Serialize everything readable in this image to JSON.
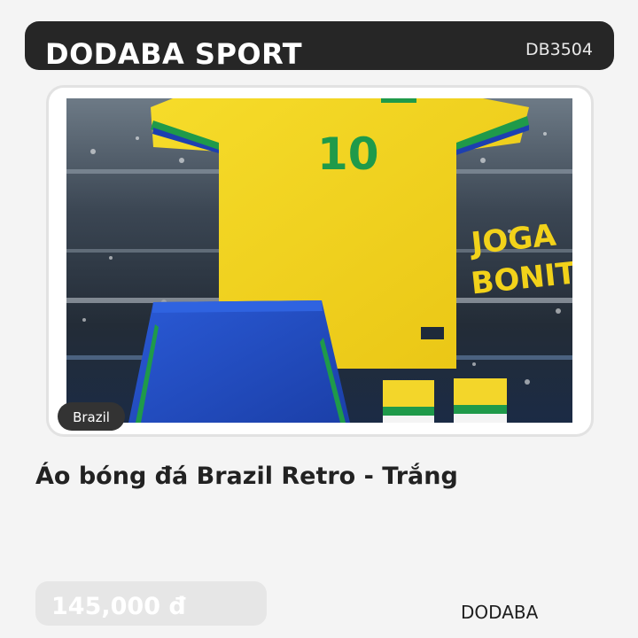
{
  "header": {
    "brand": "DODABA SPORT",
    "product_code": "DB3504"
  },
  "product": {
    "image_tag": "Brazil",
    "jersey_number": "10",
    "banner_text_line1": "JOGA",
    "banner_text_line2": "BONITO",
    "title": "Áo bóng đá Brazil Retro - Trắng",
    "price": "145,000 đ",
    "vendor": "DODABA"
  },
  "colors": {
    "header_bg": "#262626",
    "jersey_yellow": "#f2d21a",
    "jersey_green": "#1f9a4a",
    "shorts_blue": "#1f4fc4",
    "price_box": "#e6e6e6"
  }
}
